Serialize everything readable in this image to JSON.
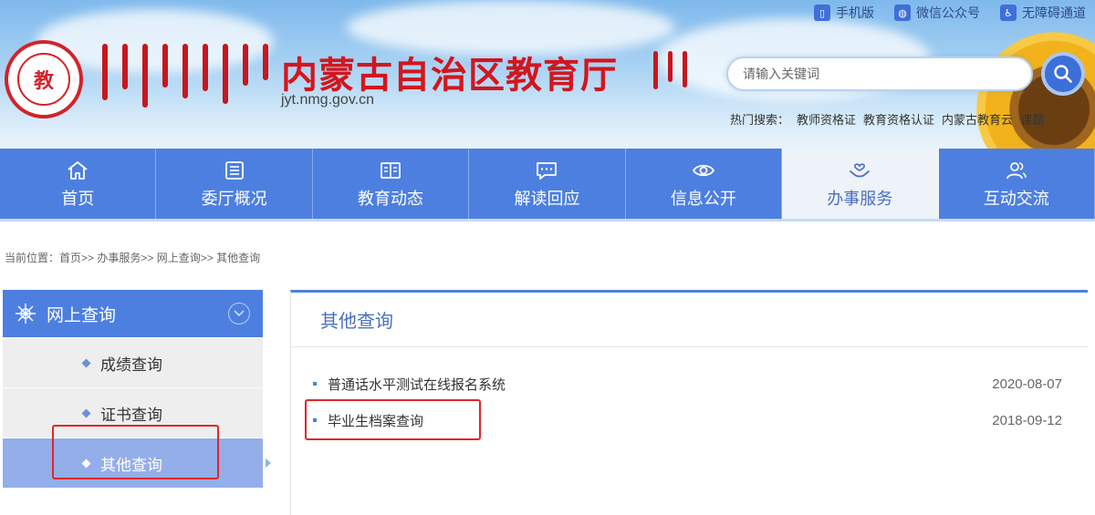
{
  "header": {
    "site_title": "内蒙古自治区教育厅",
    "domain": "jyt.nmg.gov.cn",
    "top_links": [
      {
        "label": "手机版",
        "icon": "mobile-icon"
      },
      {
        "label": "微信公众号",
        "icon": "wechat-icon"
      },
      {
        "label": "无障碍通道",
        "icon": "accessibility-icon"
      }
    ],
    "search": {
      "placeholder": "请输入关键词"
    },
    "hot_search": {
      "label": "热门搜索：",
      "items": [
        "教师资格证",
        "教育资格认证",
        "内蒙古教育云",
        "课题"
      ]
    }
  },
  "nav": {
    "items": [
      {
        "label": "首页",
        "icon": "home-icon"
      },
      {
        "label": "委厅概况",
        "icon": "list-icon"
      },
      {
        "label": "教育动态",
        "icon": "news-icon"
      },
      {
        "label": "解读回应",
        "icon": "chat-icon"
      },
      {
        "label": "信息公开",
        "icon": "eye-icon"
      },
      {
        "label": "办事服务",
        "icon": "service-icon",
        "active": true
      },
      {
        "label": "互动交流",
        "icon": "users-icon"
      }
    ]
  },
  "breadcrumb": {
    "prefix": "当前位置：",
    "items": [
      "首页>",
      " > 办事服务>",
      " > 网上查询>",
      " > 其他查询"
    ]
  },
  "sidebar": {
    "title": "网上查询",
    "items": [
      {
        "label": "成绩查询"
      },
      {
        "label": "证书查询"
      },
      {
        "label": "其他查询",
        "active": true
      }
    ]
  },
  "content": {
    "title": "其他查询",
    "rows": [
      {
        "title": "普通话水平测试在线报名系统",
        "date": "2020-08-07"
      },
      {
        "title": "毕业生档案查询",
        "date": "2018-09-12"
      }
    ]
  },
  "colors": {
    "nav_blue": "#4d7fe0",
    "title_red": "#d2161e",
    "annotation_red": "#e0252a"
  }
}
